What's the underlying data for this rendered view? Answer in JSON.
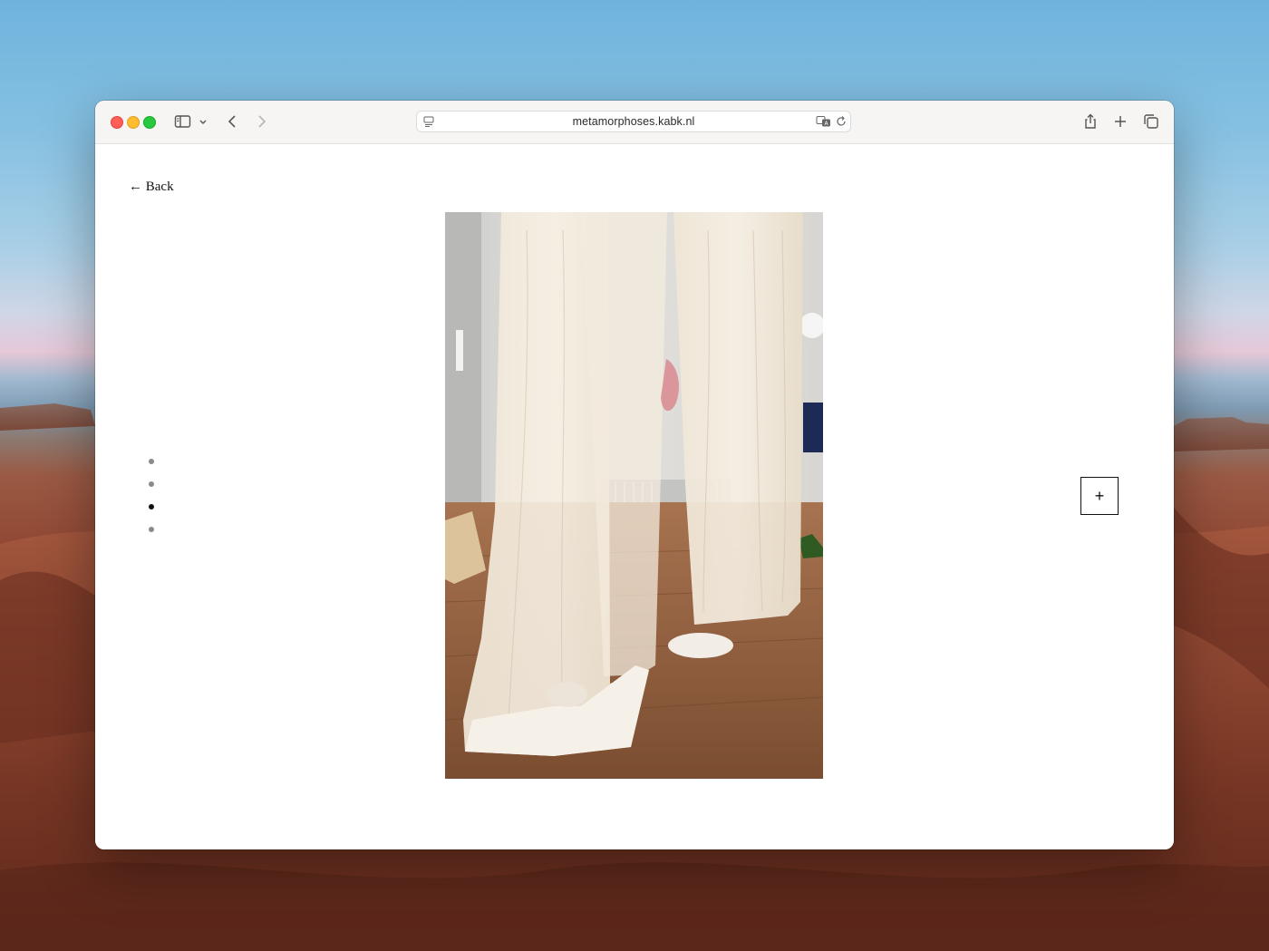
{
  "browser": {
    "url": "metamorphoses.kabk.nl",
    "icons": {
      "sidebar": "sidebar-icon",
      "sidebar_menu": "chevron-down-icon",
      "back": "chevron-left-icon",
      "forward": "chevron-right-icon",
      "page_menu": "page-settings-icon",
      "translate": "translate-icon",
      "reload": "reload-icon",
      "share": "share-icon",
      "new_tab": "plus-icon",
      "tab_overview": "tabs-icon"
    }
  },
  "page": {
    "back_label": "← Back",
    "slides": {
      "count": 4,
      "active_index": 2
    },
    "expand_label": "+",
    "image": {
      "subject": "sheer curtain installation in gallery"
    }
  },
  "colors": {
    "traffic_red": "#ff5f57",
    "traffic_yellow": "#febc2e",
    "traffic_green": "#28c840",
    "text": "#111111",
    "inactive_dot": "#8a8a8a"
  }
}
